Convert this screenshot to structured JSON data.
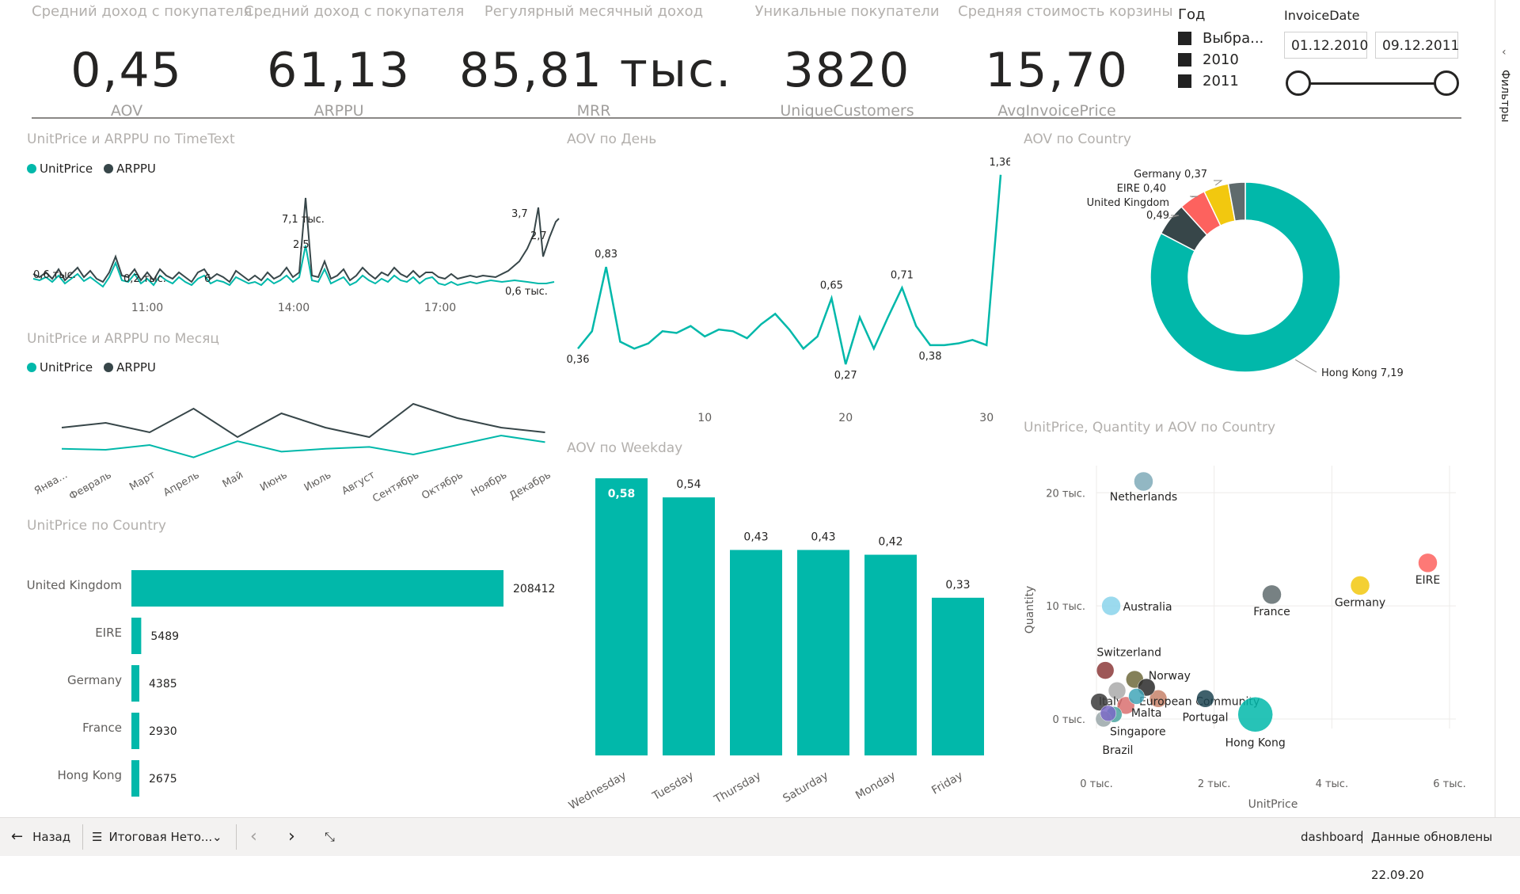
{
  "kpis": [
    {
      "caption": "Средний доход с покупателя",
      "value": "0,45",
      "label": "AOV"
    },
    {
      "caption": "Средний доход с покупателя",
      "value": "61,13",
      "label": "ARPPU"
    },
    {
      "caption": "Регулярный месячный доход",
      "value": "85,81 тыс.",
      "label": "MRR"
    },
    {
      "caption": "Уникальные покупатели",
      "value": "3820",
      "label": "UniqueCustomers"
    },
    {
      "caption": "Средняя стоимость корзины",
      "value": "15,70",
      "label": "AvgInvoicePrice"
    }
  ],
  "year_slicer": {
    "title": "Год",
    "options": [
      "Выбра...",
      "2010",
      "2011"
    ]
  },
  "date_slicer": {
    "title": "InvoiceDate",
    "start": "01.12.2010",
    "end": "09.12.2011"
  },
  "sidebar": {
    "label": "Фильтры"
  },
  "visual_titles": {
    "timetext": "UnitPrice и ARPPU по TimeText",
    "month": "UnitPrice и ARPPU по Месяц",
    "country_bar": "UnitPrice по Country",
    "day": "AOV по День",
    "weekday": "AOV по Weekday",
    "donut": "AOV по Country",
    "scatter": "UnitPrice, Quantity и AOV по Country"
  },
  "legend": {
    "s1": "UnitPrice",
    "s2": "ARPPU"
  },
  "colors": {
    "teal": "#01b8aa",
    "dark": "#374649",
    "red": "#fd625e",
    "yellow": "#f2c80f",
    "grey": "#5f6b6d",
    "lightblue": "#8ad4eb",
    "slate": "#7faab8"
  },
  "chart_data": [
    {
      "type": "line",
      "name": "timetext",
      "x_ticks": [
        "11:00",
        "14:00",
        "17:00"
      ],
      "labels": [
        "0,6 тыс.",
        "0,2 тыс.",
        "6",
        "7,1 тыс.",
        "2,5",
        "3,7",
        "2,7",
        "0,6 тыс."
      ],
      "series": [
        {
          "name": "UnitPrice"
        },
        {
          "name": "ARPPU"
        }
      ]
    },
    {
      "type": "line",
      "name": "month",
      "categories": [
        "Январь",
        "Февраль",
        "Март",
        "Апрель",
        "Май",
        "Июнь",
        "Июль",
        "Август",
        "Сентябрь",
        "Октябрь",
        "Ноябрь",
        "Декабрь"
      ],
      "category_labels": [
        "Янва...",
        "Февраль",
        "Март",
        "Апрель",
        "Май",
        "Июнь",
        "Июль",
        "Август",
        "Сентябрь",
        "Октябрь",
        "Ноябрь",
        "Декабрь"
      ],
      "series": [
        {
          "name": "UnitPrice",
          "values": [
            4.0,
            4.1,
            3.6,
            4.9,
            3.2,
            4.3,
            4.0,
            3.8,
            4.6,
            3.6,
            2.6,
            3.3
          ]
        },
        {
          "name": "ARPPU",
          "values": [
            57,
            58,
            56,
            61,
            55,
            60,
            57,
            55,
            62,
            59,
            57,
            56
          ]
        }
      ]
    },
    {
      "type": "bar",
      "name": "country_bar",
      "orientation": "horizontal",
      "categories": [
        "United Kingdom",
        "EIRE",
        "Germany",
        "France",
        "Hong Kong"
      ],
      "values": [
        208412,
        5489,
        4385,
        2930,
        2675
      ],
      "value_labels": [
        "208412",
        "5489",
        "4385",
        "2930",
        "2675"
      ]
    },
    {
      "type": "line",
      "name": "day",
      "x": [
        1,
        2,
        3,
        4,
        5,
        6,
        7,
        8,
        9,
        10,
        11,
        12,
        13,
        14,
        15,
        16,
        17,
        18,
        19,
        20,
        21,
        22,
        23,
        24,
        25,
        26,
        27,
        28,
        29,
        30,
        31
      ],
      "values": [
        0.36,
        0.46,
        0.83,
        0.4,
        0.36,
        0.39,
        0.46,
        0.45,
        0.49,
        0.43,
        0.47,
        0.46,
        0.42,
        0.5,
        0.56,
        0.47,
        0.36,
        0.43,
        0.65,
        0.27,
        0.54,
        0.36,
        0.54,
        0.71,
        0.49,
        0.38,
        0.38,
        0.39,
        0.41,
        0.38,
        1.36
      ],
      "labels": {
        "1": "0,36",
        "3": "0,83",
        "19": "0,65",
        "20": "0,27",
        "24": "0,71",
        "26": "0,38",
        "31": "1,36"
      },
      "x_ticks": [
        "10",
        "20",
        "30"
      ]
    },
    {
      "type": "bar",
      "name": "weekday",
      "categories": [
        "Wednesday",
        "Tuesday",
        "Thursday",
        "Saturday",
        "Monday",
        "Friday"
      ],
      "values": [
        0.58,
        0.54,
        0.43,
        0.43,
        0.42,
        0.33
      ],
      "value_labels": [
        "0,58",
        "0,54",
        "0,43",
        "0,43",
        "0,42",
        "0,33"
      ]
    },
    {
      "type": "pie",
      "name": "donut",
      "hole": true,
      "slices": [
        {
          "label": "Hong Kong 7,19",
          "value": 7.19,
          "color": "#01b8aa"
        },
        {
          "label": "United Kingdom 0,49",
          "value": 0.49,
          "color": "#374649"
        },
        {
          "label": "EIRE 0,40",
          "value": 0.4,
          "color": "#fd625e"
        },
        {
          "label": "Germany 0,37",
          "value": 0.37,
          "color": "#f2c80f"
        },
        {
          "label": "",
          "value": 0.25,
          "color": "#5f6b6d"
        }
      ]
    },
    {
      "type": "scatter",
      "name": "scatter",
      "xlabel": "UnitPrice",
      "ylabel": "Quantity",
      "x_ticks": [
        "0 тыс.",
        "2 тыс.",
        "4 тыс.",
        "6 тыс."
      ],
      "y_ticks": [
        "0 тыс.",
        "10 тыс.",
        "20 тыс."
      ],
      "points": [
        {
          "label": "Netherlands",
          "x": 800,
          "y": 21000,
          "size": 12,
          "color": "#7faab8"
        },
        {
          "label": "Australia",
          "x": 250,
          "y": 10000,
          "size": 12,
          "color": "#8ad4eb"
        },
        {
          "label": "France",
          "x": 2980,
          "y": 11000,
          "size": 12,
          "color": "#5f6b6d"
        },
        {
          "label": "Germany",
          "x": 4480,
          "y": 11800,
          "size": 12,
          "color": "#f2c80f"
        },
        {
          "label": "EIRE",
          "x": 5630,
          "y": 13800,
          "size": 12,
          "color": "#fd625e"
        },
        {
          "label": "Switzerland",
          "x": 150,
          "y": 4300,
          "size": 11,
          "color": "#8c3a3a"
        },
        {
          "label": "Norway",
          "x": 650,
          "y": 3500,
          "size": 11,
          "color": "#6f6a3c"
        },
        {
          "label": "Italy",
          "x": 350,
          "y": 2500,
          "size": 11,
          "color": "#aaaaaa"
        },
        {
          "label": "European Community",
          "x": 1050,
          "y": 1800,
          "size": 11,
          "color": "#c7836a"
        },
        {
          "label": "Portugal",
          "x": 1850,
          "y": 1800,
          "size": 11,
          "color": "#1d4451"
        },
        {
          "label": "Malta",
          "x": 500,
          "y": 1200,
          "size": 11,
          "color": "#d97070"
        },
        {
          "label": "Singapore",
          "x": 300,
          "y": 400,
          "size": 10,
          "color": "#4aa3a0"
        },
        {
          "label": "Brazil",
          "x": 120,
          "y": 0,
          "size": 10,
          "color": "#9aa7a9"
        },
        {
          "label": "Hong Kong",
          "x": 2700,
          "y": 400,
          "size": 22,
          "color": "#01b8aa"
        },
        {
          "label": "",
          "x": 50,
          "y": 1500,
          "size": 11,
          "color": "#3b3b3b"
        },
        {
          "label": "",
          "x": 850,
          "y": 2800,
          "size": 11,
          "color": "#2a2a2a"
        },
        {
          "label": "",
          "x": 680,
          "y": 2000,
          "size": 10,
          "color": "#42a6b8"
        },
        {
          "label": "",
          "x": 200,
          "y": 500,
          "size": 10,
          "color": "#7a6ac5"
        }
      ]
    }
  ],
  "footer": {
    "back": "Назад",
    "page": "Итоговая Нето...",
    "report": "dashboard",
    "updated": "Данные обновлены 22.09.20"
  }
}
